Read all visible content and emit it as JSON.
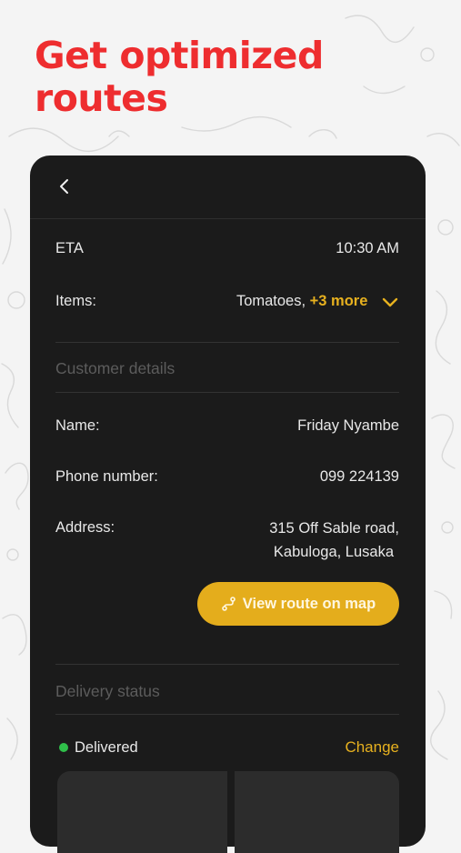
{
  "headline": {
    "line1": "Get optimized",
    "line2": "routes"
  },
  "colors": {
    "headline": "#ee2d2f",
    "card_bg": "#1b1b1b",
    "accent": "#e4ad1c",
    "status_delivered": "#2fbf4a"
  },
  "order": {
    "eta_label": "ETA",
    "eta_value": "10:30 AM",
    "items_label": "Items:",
    "items_first": "Tomatoes,",
    "items_more": "+3 more"
  },
  "customer": {
    "section_title": "Customer details",
    "name_label": "Name:",
    "name_value": "Friday Nyambe",
    "phone_label": "Phone number:",
    "phone_value": "099 224139",
    "address_label": "Address:",
    "address_line1": "315 Off Sable road,",
    "address_line2": "Kabuloga, Lusaka",
    "route_button_label": "View route on map"
  },
  "delivery": {
    "section_title": "Delivery status",
    "status": "Delivered",
    "change_label": "Change"
  },
  "icons": {
    "back": "chevron-left-icon",
    "expand": "chevron-down-icon",
    "route": "route-icon",
    "status": "status-dot"
  }
}
